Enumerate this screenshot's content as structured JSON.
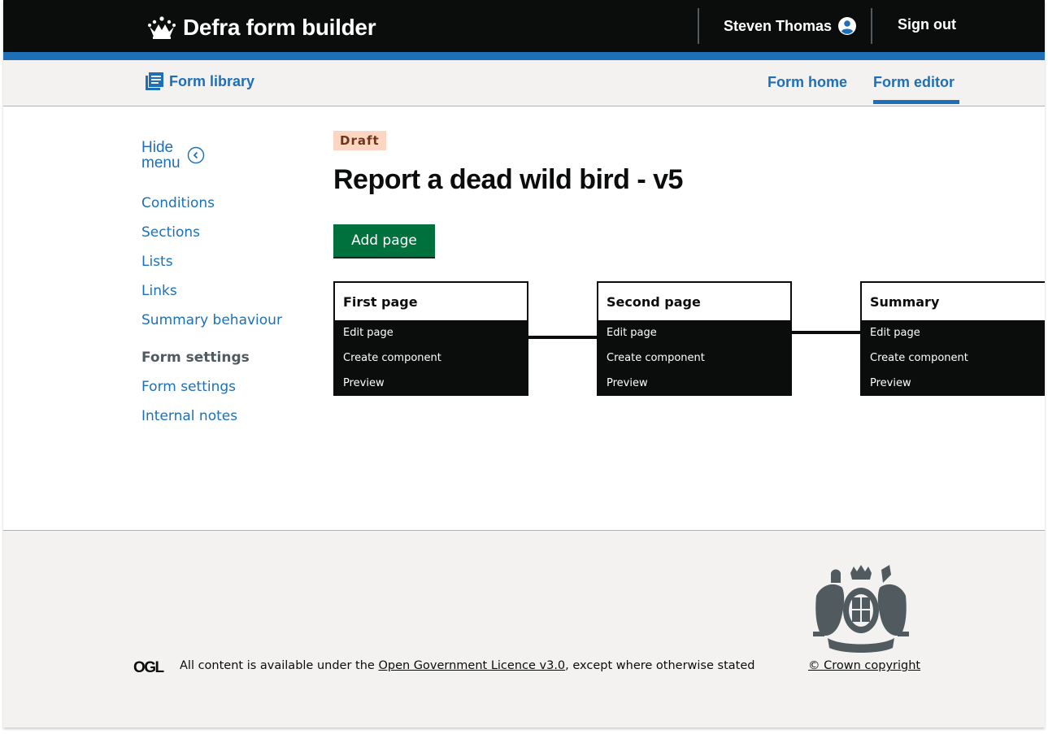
{
  "header": {
    "service_name": "Defra form builder",
    "user_name": "Steven Thomas",
    "sign_out": "Sign out",
    "logo_icon": "crown-icon",
    "user_icon": "user-circle-icon"
  },
  "subnav": {
    "library": "Form library",
    "library_icon": "library-icon",
    "form_home": "Form home",
    "form_editor": "Form editor",
    "active": "Form editor"
  },
  "sidebar": {
    "hide_menu_line1": "Hide",
    "hide_menu_line2": "menu",
    "items": [
      {
        "label": "Conditions"
      },
      {
        "label": "Sections"
      },
      {
        "label": "Lists"
      },
      {
        "label": "Links"
      },
      {
        "label": "Summary behaviour"
      }
    ],
    "settings_heading": "Form settings",
    "settings_items": [
      {
        "label": "Form settings"
      },
      {
        "label": "Internal notes"
      }
    ]
  },
  "main": {
    "status_tag": "Draft",
    "title": "Report a dead wild bird - v5",
    "add_page": "Add page",
    "pages": [
      {
        "title": "First page",
        "actions": [
          "Edit page",
          "Create component",
          "Preview"
        ]
      },
      {
        "title": "Second page",
        "actions": [
          "Edit page",
          "Create component",
          "Preview"
        ]
      },
      {
        "title": "Summary",
        "actions": [
          "Edit page",
          "Create component",
          "Preview"
        ]
      }
    ]
  },
  "footer": {
    "licence_prefix": "All content is available under the ",
    "licence_link": "Open Government Licence v3.0",
    "licence_suffix": ", except where otherwise stated",
    "copyright": "© Crown copyright",
    "ogl_text": "OGL"
  },
  "colors": {
    "header_bg": "#0b0c0c",
    "brand_blue": "#1d70b8",
    "button_green": "#00703c",
    "draft_tag_bg": "#fcd6c3",
    "draft_tag_text": "#6e3619",
    "footer_bg": "#f3f2f1"
  }
}
